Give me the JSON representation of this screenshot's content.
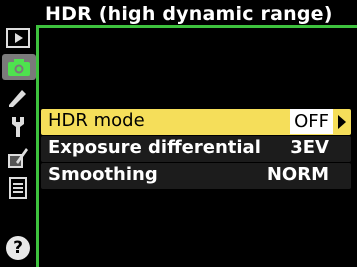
{
  "menu": {
    "title": "HDR (high dynamic range)",
    "items": [
      {
        "label": "HDR mode",
        "value": "OFF"
      },
      {
        "label": "Exposure differential",
        "value": "3EV"
      },
      {
        "label": "Smoothing",
        "value": "NORM"
      }
    ]
  },
  "sidebar": {
    "icons": [
      "playback-icon",
      "camera-icon",
      "pencil-icon",
      "wrench-icon",
      "retouch-icon",
      "recent-settings-icon"
    ],
    "active": "camera-icon"
  },
  "help_icon": "?",
  "colors": {
    "accent_green": "#3ec23e",
    "highlight_yellow": "#f5de5a",
    "active_tab_gray": "#7a7a7a"
  }
}
